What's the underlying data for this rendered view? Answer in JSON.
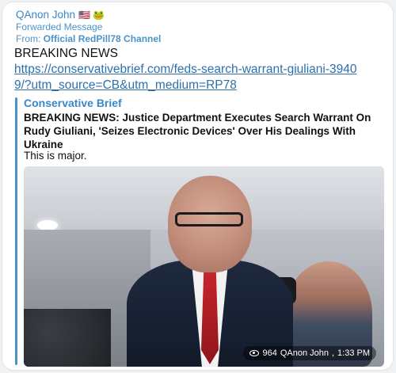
{
  "message": {
    "sender": "QAnon John",
    "sender_emojis": "🇺🇸 🐸",
    "forwarded_label": "Forwarded Message",
    "forwarded_prefix": "From:",
    "forwarded_from": "Official RedPill78 Channel",
    "text": "BREAKING NEWS",
    "link": "https://conservativebrief.com/feds-search-warrant-giuliani-39409/?utm_source=CB&utm_medium=RP78"
  },
  "preview": {
    "site": "Conservative Brief",
    "title": "BREAKING NEWS: Justice Department Executes Search Warrant On Rudy Giuliani, 'Seizes Electronic Devices' Over His Dealings With Ukraine",
    "description": "This is major.",
    "photo": "man-in-suit-with-photographers"
  },
  "meta": {
    "views": "964",
    "author": "QAnon John",
    "time": "1:33 PM",
    "icon": "eye-icon"
  },
  "colors": {
    "accent": "#3a86c8",
    "link": "#2f6fad",
    "bubble": "#ffffff"
  }
}
